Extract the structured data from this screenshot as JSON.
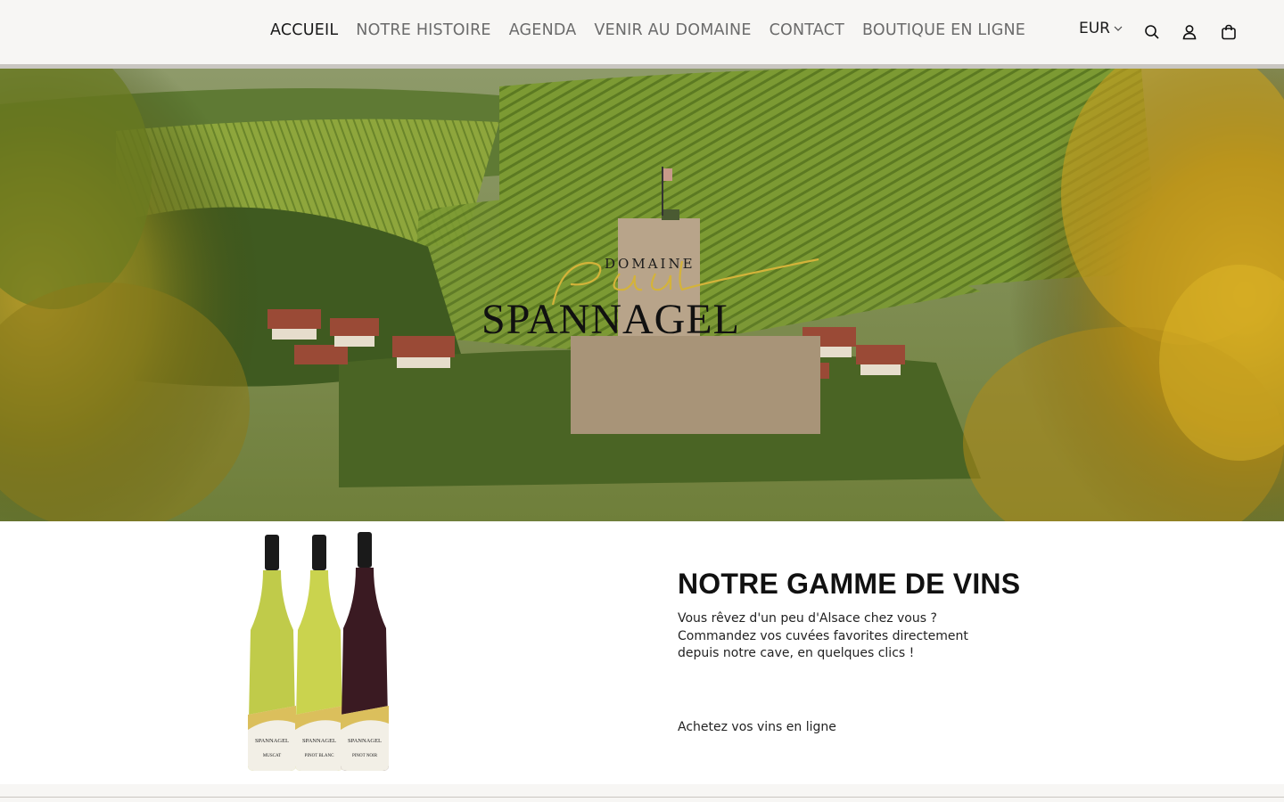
{
  "nav": {
    "items": [
      {
        "label": "ACCUEIL",
        "active": true
      },
      {
        "label": "NOTRE HISTOIRE",
        "active": false
      },
      {
        "label": "AGENDA",
        "active": false
      },
      {
        "label": "VENIR AU DOMAINE",
        "active": false
      },
      {
        "label": "CONTACT",
        "active": false
      },
      {
        "label": "BOUTIQUE EN LIGNE",
        "active": false
      }
    ]
  },
  "utilities": {
    "currency": "EUR",
    "icons": [
      "search-icon",
      "account-icon",
      "cart-icon"
    ]
  },
  "hero": {
    "logo_top": "DOMAINE",
    "logo_script": "Paul",
    "logo_main": "SPANNAGEL"
  },
  "wine_section": {
    "title": "NOTRE GAMME DE VINS",
    "description_lines": [
      "Vous rêvez d'un peu d'Alsace chez vous ?",
      "Commandez vos cuvées favorites directement",
      "depuis notre cave, en quelques clics !"
    ],
    "link": "Achetez vos vins en ligne",
    "bottles": [
      {
        "brand": "SPANNAGEL",
        "variety": "MUSCAT",
        "color": "#c4cf4a"
      },
      {
        "brand": "SPANNAGEL",
        "variety": "PINOT BLANC",
        "color": "#c9d34c"
      },
      {
        "brand": "SPANNAGEL",
        "variety": "PINOT NOIR",
        "color": "#3a1a22"
      }
    ]
  },
  "colors": {
    "header_bg": "#f7f6f4",
    "accent_gold": "#d4b33a",
    "text_dark": "#1a1a1a"
  }
}
